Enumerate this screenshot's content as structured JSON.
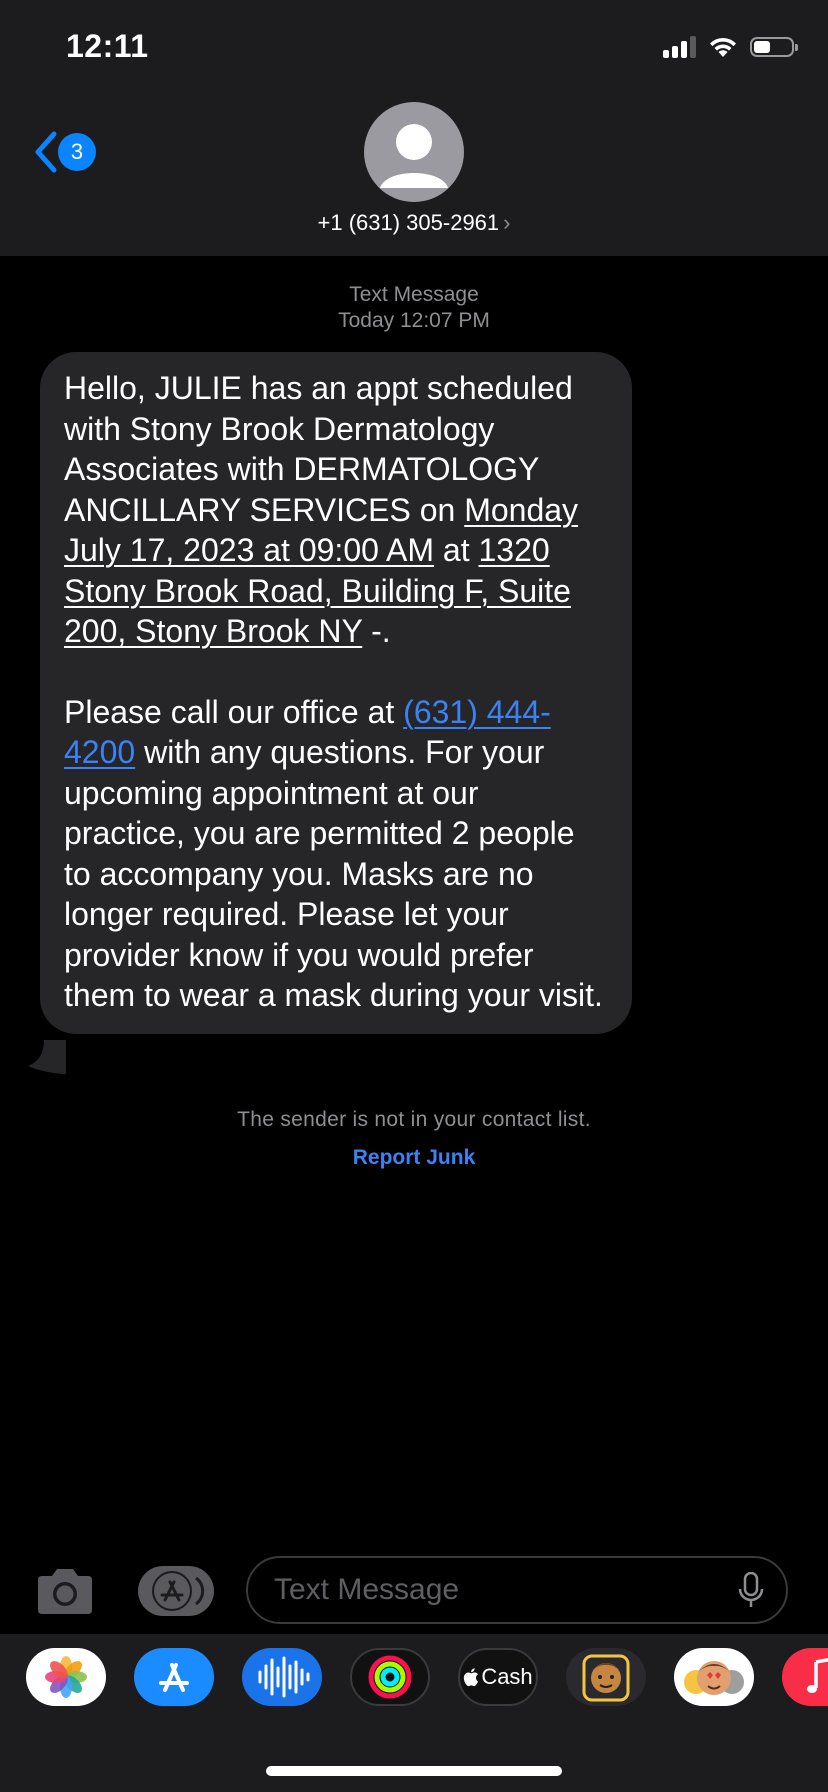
{
  "status_bar": {
    "time": "12:11",
    "battery_level": 0.45
  },
  "header": {
    "back_badge_count": "3",
    "contact_name": "+1 (631) 305-2961",
    "chevron": "›"
  },
  "message_meta": {
    "type": "Text Message",
    "timestamp": "Today 12:07 PM"
  },
  "message": {
    "p1_intro": "Hello, JULIE has an appt scheduled with Stony Brook Dermatology Associates with DERMATOLOGY ANCILLARY SERVICES on ",
    "p1_date": "Monday July 17, 2023 at 09:00 AM",
    "p1_at": " at ",
    "p1_address": "1320 Stony Brook Road, Building F, Suite 200, Stony Brook NY",
    "p1_end": " -.",
    "p2_intro": "Please call our office at ",
    "p2_phone": "(631) 444-4200",
    "p2_rest": " with any questions. For your upcoming appointment at our practice, you are permitted 2 people to accompany you. Masks are no longer required. Please let your provider know if you would prefer them to wear a mask during your visit."
  },
  "notice": {
    "not_in_contacts": "The sender is not in your contact list.",
    "report_junk": "Report Junk"
  },
  "input": {
    "placeholder": "Text Message"
  },
  "app_drawer": {
    "cash_label": "Cash",
    "apps": [
      "photos-icon",
      "app-store-icon",
      "audio-messages-icon",
      "activity-icon",
      "apple-cash-icon",
      "memoji-icon",
      "animoji-icon",
      "music-icon"
    ]
  },
  "colors": {
    "accent": "#0a84ff",
    "link": "#3b82f6",
    "bubble": "#262629",
    "header": "#1c1c1e"
  }
}
